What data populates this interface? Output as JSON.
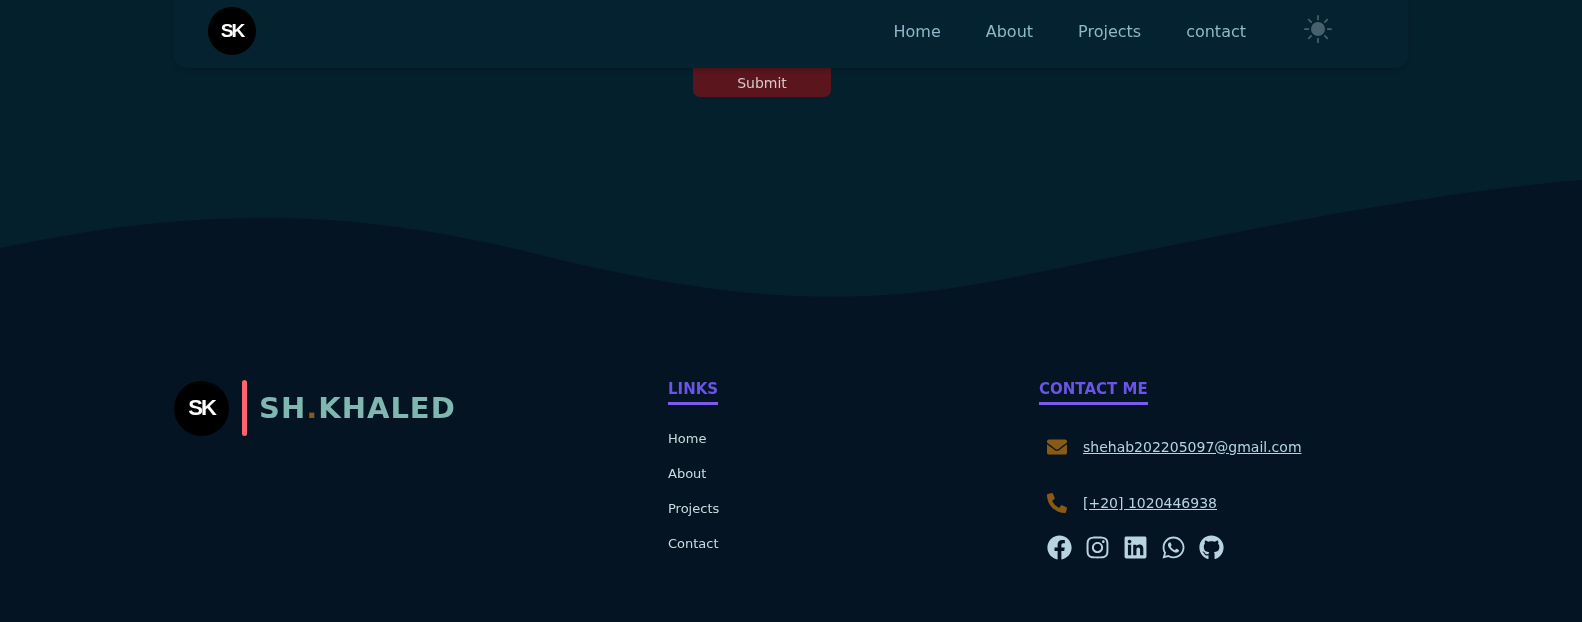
{
  "nav": {
    "logo": "SK",
    "links": [
      {
        "label": "Home"
      },
      {
        "label": "About"
      },
      {
        "label": "Projects"
      },
      {
        "label": "contact"
      }
    ]
  },
  "form": {
    "submit": "Submit"
  },
  "footer": {
    "logo": "SK",
    "brand": [
      "SH",
      ".",
      "KHALED"
    ],
    "links": {
      "title": "LINKS",
      "items": [
        "Home",
        "About",
        "Projects",
        "Contact"
      ]
    },
    "contact": {
      "title": "CONTACT ME",
      "items": [
        {
          "kind": "email",
          "text": "shehab202205097@gmail.com"
        },
        {
          "kind": "phone",
          "text": "[+20] 1020446938"
        }
      ],
      "socials": [
        {
          "kind": "facebook"
        },
        {
          "kind": "instagram"
        },
        {
          "kind": "linkedin"
        },
        {
          "kind": "whatsapp"
        },
        {
          "kind": "github"
        }
      ]
    }
  }
}
